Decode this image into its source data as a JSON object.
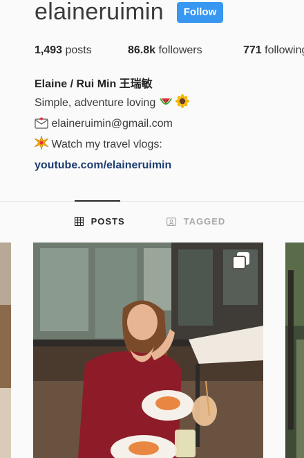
{
  "profile": {
    "username": "elaineruimin",
    "follow_label": "Follow",
    "accent_color": "#3897f0"
  },
  "stats": {
    "posts_count": "1,493",
    "posts_label": " posts",
    "followers_count": "86.8k",
    "followers_label": " followers",
    "following_count": "771",
    "following_label": " following"
  },
  "bio": {
    "name": "Elaine / Rui Min 王瑞敏",
    "tagline": "Simple, adventure loving",
    "email": "elaineruimin@gmail.com",
    "vlog_text": "Watch my travel vlogs:",
    "link": "youtube.com/elaineruimin",
    "icons": [
      "watermelon-emoji",
      "sunflower-emoji",
      "envelope-emoji",
      "sparkle-emoji"
    ]
  },
  "tabs": [
    {
      "label": "POSTS",
      "icon": "grid-icon",
      "active": true
    },
    {
      "label": "TAGGED",
      "icon": "tag-icon",
      "active": false
    }
  ]
}
